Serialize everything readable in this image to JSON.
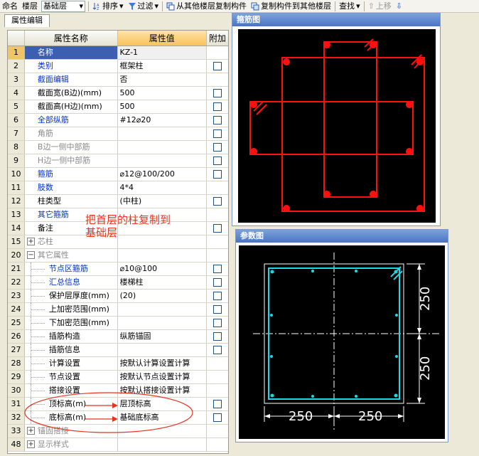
{
  "toolbar": {
    "rename": "命名",
    "floor_label": "楼层",
    "floor_value": "基础层",
    "sort": "排序",
    "filter": "过滤",
    "copy_from_floor": "从其他楼层复制构件",
    "copy_to_floor": "复制构件到其他楼层",
    "find": "查找",
    "move_up": "上移"
  },
  "tab": "属性编辑",
  "grid": {
    "headers": [
      "",
      "属性名称",
      "属性值",
      "附加"
    ],
    "rows": [
      {
        "num": "1",
        "name": "名称",
        "value": "KZ-1",
        "style": "sel",
        "check": false
      },
      {
        "num": "2",
        "name": "类别",
        "value": "框架柱",
        "style": "blue",
        "check": true
      },
      {
        "num": "3",
        "name": "截面编辑",
        "value": "否",
        "style": "blue",
        "check": false
      },
      {
        "num": "4",
        "name": "截面宽(B边)(mm)",
        "value": "500",
        "style": "",
        "check": true
      },
      {
        "num": "5",
        "name": "截面高(H边)(mm)",
        "value": "500",
        "style": "",
        "check": true
      },
      {
        "num": "6",
        "name": "全部纵筋",
        "value": "#12⌀20",
        "style": "blue",
        "check": true
      },
      {
        "num": "7",
        "name": "角筋",
        "value": "",
        "style": "gray",
        "check": true
      },
      {
        "num": "8",
        "name": "B边一侧中部筋",
        "value": "",
        "style": "gray",
        "check": true
      },
      {
        "num": "9",
        "name": "H边一侧中部筋",
        "value": "",
        "style": "gray",
        "check": true
      },
      {
        "num": "10",
        "name": "箍筋",
        "value": "⌀12@100/200",
        "style": "blue",
        "check": true
      },
      {
        "num": "11",
        "name": "肢数",
        "value": "4*4",
        "style": "blue",
        "check": false
      },
      {
        "num": "12",
        "name": "柱类型",
        "value": "(中柱)",
        "style": "",
        "check": true
      },
      {
        "num": "13",
        "name": "其它箍筋",
        "value": "",
        "style": "blue",
        "check": false
      },
      {
        "num": "14",
        "name": "备注",
        "value": "",
        "style": "",
        "check": true
      },
      {
        "num": "15",
        "name": "芯柱",
        "value": "",
        "style": "gray-exp",
        "check": false
      },
      {
        "num": "20",
        "name": "其它属性",
        "value": "",
        "style": "gray-col",
        "check": false
      },
      {
        "num": "21",
        "name": "节点区箍筋",
        "value": "⌀10@100",
        "style": "blue-child",
        "check": true
      },
      {
        "num": "22",
        "name": "汇总信息",
        "value": "楼梯柱",
        "style": "blue-child",
        "check": true
      },
      {
        "num": "23",
        "name": "保护层厚度(mm)",
        "value": "(20)",
        "style": "child",
        "check": true
      },
      {
        "num": "24",
        "name": "上加密范围(mm)",
        "value": "",
        "style": "child",
        "check": true
      },
      {
        "num": "25",
        "name": "下加密范围(mm)",
        "value": "",
        "style": "child",
        "check": true
      },
      {
        "num": "26",
        "name": "插筋构造",
        "value": "纵筋锚固",
        "style": "child",
        "check": true
      },
      {
        "num": "27",
        "name": "插筋信息",
        "value": "",
        "style": "child",
        "check": true
      },
      {
        "num": "28",
        "name": "计算设置",
        "value": "按默认计算设置计算",
        "style": "child",
        "check": false
      },
      {
        "num": "29",
        "name": "节点设置",
        "value": "按默认节点设置计算",
        "style": "child",
        "check": false
      },
      {
        "num": "30",
        "name": "搭接设置",
        "value": "按默认搭接设置计算",
        "style": "child",
        "check": false
      },
      {
        "num": "31",
        "name": "顶标高(m)",
        "value": "层顶标高",
        "style": "child",
        "check": true
      },
      {
        "num": "32",
        "name": "底标高(m)",
        "value": "基础底标高",
        "style": "child",
        "check": true
      },
      {
        "num": "33",
        "name": "锚固搭接",
        "value": "",
        "style": "gray-exp",
        "check": false
      },
      {
        "num": "48",
        "name": "显示样式",
        "value": "",
        "style": "gray-exp",
        "check": false
      }
    ]
  },
  "annotation": {
    "line1": "把首层的柱复制到",
    "line2": "基础层"
  },
  "stirrup_panel": {
    "title": "箍筋图"
  },
  "param_panel": {
    "title": "参数图",
    "dim_right_top": "250",
    "dim_right_bottom": "250",
    "dim_bottom_left": "250",
    "dim_bottom_right": "250"
  },
  "colors": {
    "stirrup": "#ff1010",
    "param": "#19d8e8",
    "annotation": "#e8331e"
  }
}
